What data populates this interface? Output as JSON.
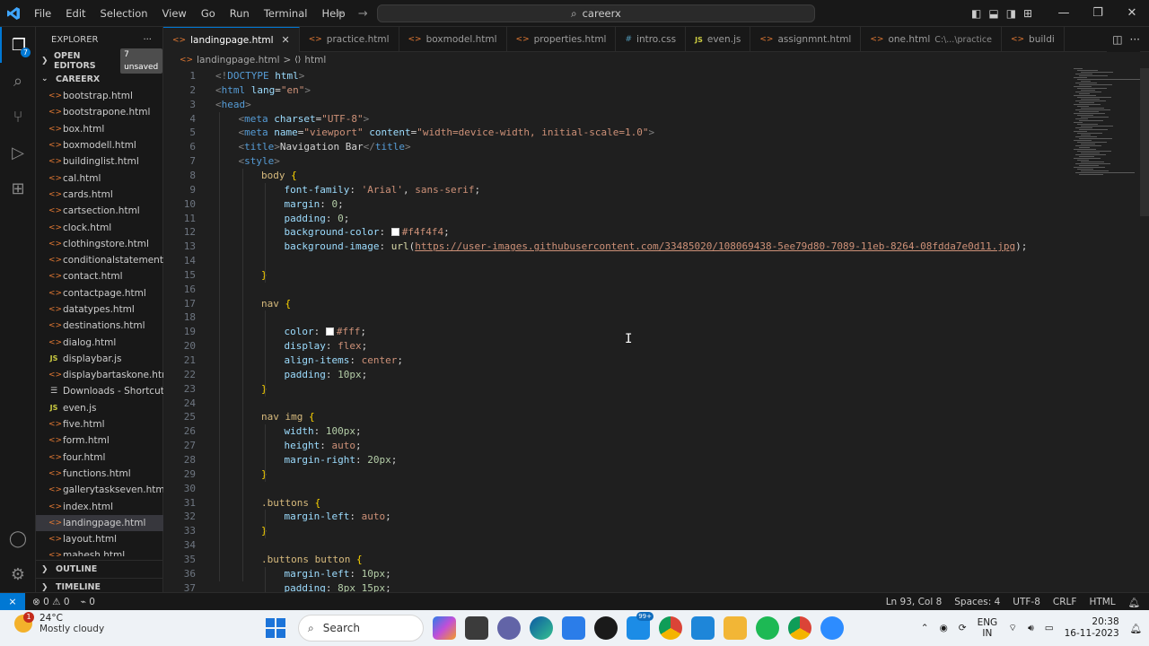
{
  "window": {
    "menu": [
      "File",
      "Edit",
      "Selection",
      "View",
      "Go",
      "Run",
      "Terminal",
      "Help"
    ],
    "search_text": "careerx"
  },
  "activity": {
    "explorer_badge": "7"
  },
  "sidebar": {
    "title": "EXPLORER",
    "more": "···",
    "open_editors_label": "OPEN EDITORS",
    "unsaved_label": "7 unsaved",
    "folder_label": "CAREERX",
    "files": [
      {
        "name": "bootstrap.html",
        "type": "html"
      },
      {
        "name": "bootstrapone.html",
        "type": "html"
      },
      {
        "name": "box.html",
        "type": "html"
      },
      {
        "name": "boxmodell.html",
        "type": "html"
      },
      {
        "name": "buildinglist.html",
        "type": "html"
      },
      {
        "name": "cal.html",
        "type": "html"
      },
      {
        "name": "cards.html",
        "type": "html"
      },
      {
        "name": "cartsection.html",
        "type": "html"
      },
      {
        "name": "clock.html",
        "type": "html"
      },
      {
        "name": "clothingstore.html",
        "type": "html"
      },
      {
        "name": "conditionalstatement...",
        "type": "html"
      },
      {
        "name": "contact.html",
        "type": "html"
      },
      {
        "name": "contactpage.html",
        "type": "html"
      },
      {
        "name": "datatypes.html",
        "type": "html"
      },
      {
        "name": "destinations.html",
        "type": "html"
      },
      {
        "name": "dialog.html",
        "type": "html"
      },
      {
        "name": "displaybar.js",
        "type": "js"
      },
      {
        "name": "displaybartaskone.html",
        "type": "html"
      },
      {
        "name": "Downloads - Shortcut...",
        "type": "link"
      },
      {
        "name": "even.js",
        "type": "js"
      },
      {
        "name": "five.html",
        "type": "html"
      },
      {
        "name": "form.html",
        "type": "html"
      },
      {
        "name": "four.html",
        "type": "html"
      },
      {
        "name": "functions.html",
        "type": "html"
      },
      {
        "name": "gallerytaskseven.html",
        "type": "html"
      },
      {
        "name": "index.html",
        "type": "html"
      },
      {
        "name": "landingpage.html",
        "type": "html",
        "active": true
      },
      {
        "name": "layout.html",
        "type": "html"
      },
      {
        "name": "mahesh.html",
        "type": "html"
      }
    ],
    "outline_label": "OUTLINE",
    "timeline_label": "TIMELINE"
  },
  "tabs": [
    {
      "label": "landingpage.html",
      "type": "html",
      "active": true,
      "dir": ""
    },
    {
      "label": "practice.html",
      "type": "html",
      "dir": ""
    },
    {
      "label": "boxmodel.html",
      "type": "html",
      "dir": ""
    },
    {
      "label": "properties.html",
      "type": "html",
      "dir": ""
    },
    {
      "label": "intro.css",
      "type": "css",
      "dir": ""
    },
    {
      "label": "even.js",
      "type": "js",
      "dir": ""
    },
    {
      "label": "assignmnt.html",
      "type": "html",
      "dir": ""
    },
    {
      "label": "one.html",
      "type": "html",
      "dir": "C:\\...\\practice"
    },
    {
      "label": "buildi",
      "type": "html",
      "dir": ""
    }
  ],
  "breadcrumb": {
    "file": "landingpage.html",
    "sep": ">",
    "symbol": "html"
  },
  "code_lines": [
    {
      "n": "1",
      "indent": 0,
      "tokens": [
        [
          "pun",
          "<!"
        ],
        [
          "tag",
          "DOCTYPE"
        ],
        [
          "attr",
          " html"
        ],
        [
          "pun",
          ">"
        ]
      ]
    },
    {
      "n": "2",
      "indent": 0,
      "tokens": [
        [
          "pun",
          "<"
        ],
        [
          "tag",
          "html"
        ],
        [
          "attr",
          " lang"
        ],
        [
          "txt",
          "="
        ],
        [
          "str",
          "\"en\""
        ],
        [
          "pun",
          ">"
        ]
      ]
    },
    {
      "n": "3",
      "indent": 0,
      "tokens": [
        [
          "pun",
          "<"
        ],
        [
          "tag",
          "head"
        ],
        [
          "pun",
          ">"
        ]
      ]
    },
    {
      "n": "4",
      "indent": 1,
      "tokens": [
        [
          "pun",
          "<"
        ],
        [
          "tag",
          "meta"
        ],
        [
          "attr",
          " charset"
        ],
        [
          "txt",
          "="
        ],
        [
          "str",
          "\"UTF-8\""
        ],
        [
          "pun",
          ">"
        ]
      ]
    },
    {
      "n": "5",
      "indent": 1,
      "tokens": [
        [
          "pun",
          "<"
        ],
        [
          "tag",
          "meta"
        ],
        [
          "attr",
          " name"
        ],
        [
          "txt",
          "="
        ],
        [
          "str",
          "\"viewport\""
        ],
        [
          "attr",
          " content"
        ],
        [
          "txt",
          "="
        ],
        [
          "str",
          "\"width=device-width, initial-scale=1.0\""
        ],
        [
          "pun",
          ">"
        ]
      ]
    },
    {
      "n": "6",
      "indent": 1,
      "tokens": [
        [
          "pun",
          "<"
        ],
        [
          "tag",
          "title"
        ],
        [
          "pun",
          ">"
        ],
        [
          "txt",
          "Navigation Bar"
        ],
        [
          "pun",
          "</"
        ],
        [
          "tag",
          "title"
        ],
        [
          "pun",
          ">"
        ]
      ]
    },
    {
      "n": "7",
      "indent": 1,
      "tokens": [
        [
          "pun",
          "<"
        ],
        [
          "tag",
          "style"
        ],
        [
          "pun",
          ">"
        ]
      ]
    },
    {
      "n": "8",
      "indent": 2,
      "tokens": [
        [
          "sel",
          "body"
        ],
        [
          "txt",
          " "
        ],
        [
          "brace",
          "{"
        ]
      ]
    },
    {
      "n": "9",
      "indent": 3,
      "tokens": [
        [
          "prop",
          "font-family"
        ],
        [
          "txt",
          ": "
        ],
        [
          "val",
          "'Arial'"
        ],
        [
          "txt",
          ", "
        ],
        [
          "val",
          "sans-serif"
        ],
        [
          "txt",
          ";"
        ]
      ]
    },
    {
      "n": "10",
      "indent": 3,
      "tokens": [
        [
          "prop",
          "margin"
        ],
        [
          "txt",
          ": "
        ],
        [
          "num",
          "0"
        ],
        [
          "txt",
          ";"
        ]
      ]
    },
    {
      "n": "11",
      "indent": 3,
      "tokens": [
        [
          "prop",
          "padding"
        ],
        [
          "txt",
          ": "
        ],
        [
          "num",
          "0"
        ],
        [
          "txt",
          ";"
        ]
      ]
    },
    {
      "n": "12",
      "indent": 3,
      "tokens": [
        [
          "prop",
          "background-color"
        ],
        [
          "txt",
          ": "
        ],
        [
          "swatch",
          ""
        ],
        [
          "val",
          "#f4f4f4"
        ],
        [
          "txt",
          ";"
        ]
      ]
    },
    {
      "n": "13",
      "indent": 3,
      "tokens": [
        [
          "prop",
          "background-image"
        ],
        [
          "txt",
          ": "
        ],
        [
          "fn",
          "url"
        ],
        [
          "txt",
          "("
        ],
        [
          "url",
          "https://user-images.githubusercontent.com/33485020/108069438-5ee79d80-7089-11eb-8264-08fdda7e0d11.jpg"
        ],
        [
          "txt",
          ");"
        ]
      ]
    },
    {
      "n": "14",
      "indent": 0,
      "tokens": []
    },
    {
      "n": "15",
      "indent": 2,
      "tokens": [
        [
          "brace",
          "}"
        ]
      ]
    },
    {
      "n": "16",
      "indent": 0,
      "tokens": []
    },
    {
      "n": "17",
      "indent": 2,
      "tokens": [
        [
          "sel",
          "nav"
        ],
        [
          "txt",
          " "
        ],
        [
          "brace",
          "{"
        ]
      ]
    },
    {
      "n": "18",
      "indent": 0,
      "tokens": []
    },
    {
      "n": "19",
      "indent": 3,
      "tokens": [
        [
          "prop",
          "color"
        ],
        [
          "txt",
          ": "
        ],
        [
          "swatch",
          ""
        ],
        [
          "val",
          "#fff"
        ],
        [
          "txt",
          ";"
        ]
      ]
    },
    {
      "n": "20",
      "indent": 3,
      "tokens": [
        [
          "prop",
          "display"
        ],
        [
          "txt",
          ": "
        ],
        [
          "val",
          "flex"
        ],
        [
          "txt",
          ";"
        ]
      ]
    },
    {
      "n": "21",
      "indent": 3,
      "tokens": [
        [
          "prop",
          "align-items"
        ],
        [
          "txt",
          ": "
        ],
        [
          "val",
          "center"
        ],
        [
          "txt",
          ";"
        ]
      ]
    },
    {
      "n": "22",
      "indent": 3,
      "tokens": [
        [
          "prop",
          "padding"
        ],
        [
          "txt",
          ": "
        ],
        [
          "num",
          "10px"
        ],
        [
          "txt",
          ";"
        ]
      ]
    },
    {
      "n": "23",
      "indent": 2,
      "tokens": [
        [
          "brace",
          "}"
        ]
      ]
    },
    {
      "n": "24",
      "indent": 0,
      "tokens": []
    },
    {
      "n": "25",
      "indent": 2,
      "tokens": [
        [
          "sel",
          "nav img"
        ],
        [
          "txt",
          " "
        ],
        [
          "brace",
          "{"
        ]
      ]
    },
    {
      "n": "26",
      "indent": 3,
      "tokens": [
        [
          "prop",
          "width"
        ],
        [
          "txt",
          ": "
        ],
        [
          "num",
          "100px"
        ],
        [
          "txt",
          ";"
        ]
      ]
    },
    {
      "n": "27",
      "indent": 3,
      "tokens": [
        [
          "prop",
          "height"
        ],
        [
          "txt",
          ": "
        ],
        [
          "val",
          "auto"
        ],
        [
          "txt",
          ";"
        ]
      ]
    },
    {
      "n": "28",
      "indent": 3,
      "tokens": [
        [
          "prop",
          "margin-right"
        ],
        [
          "txt",
          ": "
        ],
        [
          "num",
          "20px"
        ],
        [
          "txt",
          ";"
        ]
      ]
    },
    {
      "n": "29",
      "indent": 2,
      "tokens": [
        [
          "brace",
          "}"
        ]
      ]
    },
    {
      "n": "30",
      "indent": 0,
      "tokens": []
    },
    {
      "n": "31",
      "indent": 2,
      "tokens": [
        [
          "sel",
          ".buttons"
        ],
        [
          "txt",
          " "
        ],
        [
          "brace",
          "{"
        ]
      ]
    },
    {
      "n": "32",
      "indent": 3,
      "tokens": [
        [
          "prop",
          "margin-left"
        ],
        [
          "txt",
          ": "
        ],
        [
          "val",
          "auto"
        ],
        [
          "txt",
          ";"
        ]
      ]
    },
    {
      "n": "33",
      "indent": 2,
      "tokens": [
        [
          "brace",
          "}"
        ]
      ]
    },
    {
      "n": "34",
      "indent": 0,
      "tokens": []
    },
    {
      "n": "35",
      "indent": 2,
      "tokens": [
        [
          "sel",
          ".buttons button"
        ],
        [
          "txt",
          " "
        ],
        [
          "brace",
          "{"
        ]
      ]
    },
    {
      "n": "36",
      "indent": 3,
      "tokens": [
        [
          "prop",
          "margin-left"
        ],
        [
          "txt",
          ": "
        ],
        [
          "num",
          "10px"
        ],
        [
          "txt",
          ";"
        ]
      ]
    },
    {
      "n": "37",
      "indent": 3,
      "tokens": [
        [
          "prop",
          "padding"
        ],
        [
          "txt",
          ": "
        ],
        [
          "num",
          "8px 15px"
        ],
        [
          "txt",
          ";"
        ]
      ]
    }
  ],
  "status": {
    "errors": "⊗ 0 ⚠ 0",
    "ports": "⌁ 0",
    "position": "Ln 93, Col 8",
    "spaces": "Spaces: 4",
    "encoding": "UTF-8",
    "eol": "CRLF",
    "language": "HTML"
  },
  "taskbar": {
    "weather_badge": "1",
    "temperature": "24°C",
    "condition": "Mostly cloudy",
    "search_label": "Search",
    "mail_badge": "99+",
    "lang_top": "ENG",
    "lang_bottom": "IN",
    "time": "20:38",
    "date": "16-11-2023"
  },
  "colors": {
    "accent": "#0078d4",
    "editor_bg": "#1f1f1f",
    "sidebar_bg": "#181818",
    "taskbar_bg": "#eef2f6"
  }
}
